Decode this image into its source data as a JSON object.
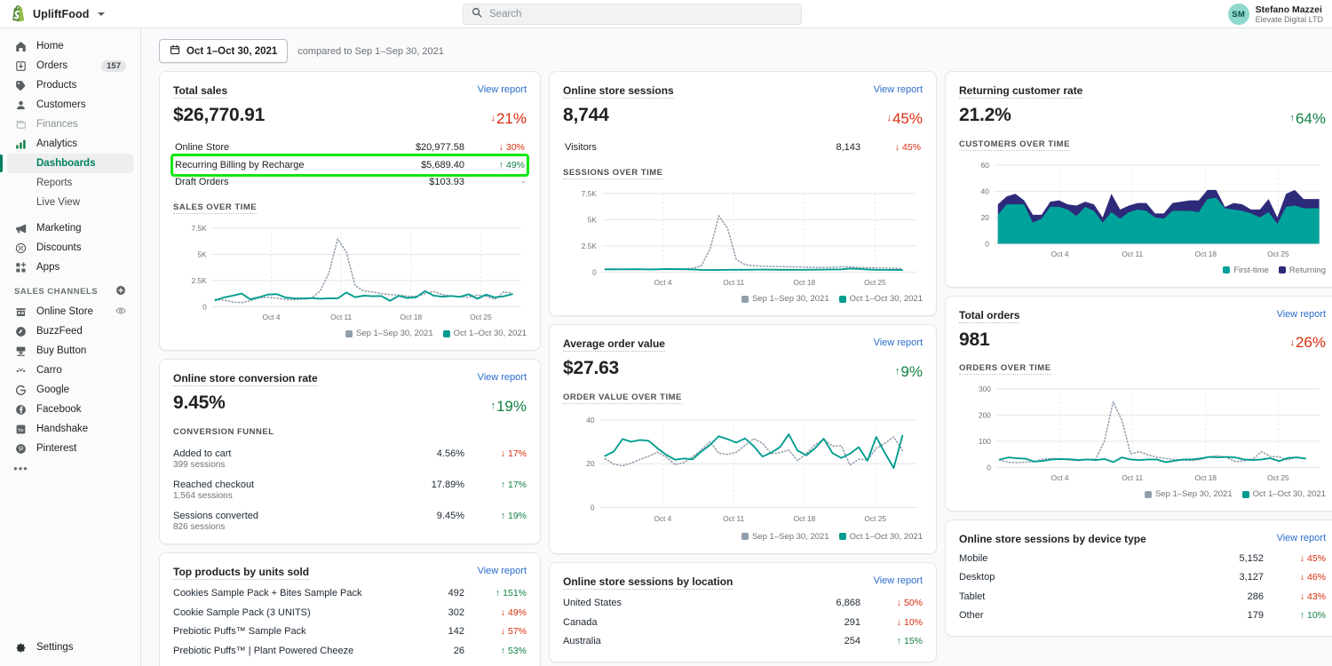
{
  "topbar": {
    "brand_name": "UpliftFood",
    "search_placeholder": "Search",
    "search_value": "",
    "user_initials": "SM",
    "user_name": "Stefano Mazzei",
    "user_org": "Elevate Digital LTD"
  },
  "sidebar": {
    "items": [
      {
        "label": "Home",
        "icon": "home-icon",
        "badge": ""
      },
      {
        "label": "Orders",
        "icon": "orders-icon",
        "badge": "157"
      },
      {
        "label": "Products",
        "icon": "products-icon",
        "badge": ""
      },
      {
        "label": "Customers",
        "icon": "customers-icon",
        "badge": ""
      },
      {
        "label": "Finances",
        "icon": "finances-icon",
        "badge": "",
        "muted": true
      },
      {
        "label": "Analytics",
        "icon": "analytics-icon",
        "badge": ""
      }
    ],
    "analytics_sub": [
      {
        "label": "Dashboards",
        "active": true
      },
      {
        "label": "Reports",
        "active": false
      },
      {
        "label": "Live View",
        "active": false
      }
    ],
    "items2": [
      {
        "label": "Marketing",
        "icon": "marketing-icon"
      },
      {
        "label": "Discounts",
        "icon": "discounts-icon"
      },
      {
        "label": "Apps",
        "icon": "apps-icon"
      }
    ],
    "channels_header": "SALES CHANNELS",
    "channels": [
      {
        "label": "Online Store",
        "icon": "store-icon",
        "eye": true
      },
      {
        "label": "BuzzFeed",
        "icon": "buzzfeed-icon"
      },
      {
        "label": "Buy Button",
        "icon": "buy-button-icon"
      },
      {
        "label": "Carro",
        "icon": "carro-icon"
      },
      {
        "label": "Google",
        "icon": "google-icon"
      },
      {
        "label": "Facebook",
        "icon": "facebook-icon"
      },
      {
        "label": "Handshake",
        "icon": "handshake-icon"
      },
      {
        "label": "Pinterest",
        "icon": "pinterest-icon"
      }
    ],
    "more_label": "•••",
    "settings_label": "Settings"
  },
  "daterange": {
    "selected": "Oct 1–Oct 30, 2021",
    "compare_text": "compared to Sep 1–Sep 30, 2021"
  },
  "common": {
    "view_report": "View report",
    "legend_previous": "Sep 1–Sep 30, 2021",
    "legend_current": "Oct 1–Oct 30, 2021",
    "color_current": "#009c8f",
    "color_previous": "#919eab",
    "color_returning": "#2e2a7a",
    "color_up": "#108043",
    "color_down": "#d72c0d",
    "highlight_color": "#12e712"
  },
  "cards": {
    "total_sales": {
      "title": "Total sales",
      "value": "$26,770.91",
      "delta": "21%",
      "delta_dir": "down",
      "rows": [
        {
          "name": "Online Store",
          "value": "$20,977.58",
          "change": "30%",
          "dir": "down",
          "highlighted": false
        },
        {
          "name": "Recurring Billing by Recharge",
          "value": "$5,689.40",
          "change": "49%",
          "dir": "up",
          "highlighted": true
        },
        {
          "name": "Draft Orders",
          "value": "$103.93",
          "change": "-",
          "dir": "none",
          "highlighted": false
        }
      ],
      "chart_label": "SALES OVER TIME"
    },
    "conversion": {
      "title": "Online store conversion rate",
      "value": "9.45%",
      "delta": "19%",
      "delta_dir": "up",
      "funnel_label": "CONVERSION FUNNEL",
      "funnel": [
        {
          "name": "Added to cart",
          "sub": "399 sessions",
          "pct": "4.56%",
          "change": "17%",
          "dir": "down"
        },
        {
          "name": "Reached checkout",
          "sub": "1,564 sessions",
          "pct": "17.89%",
          "change": "17%",
          "dir": "up"
        },
        {
          "name": "Sessions converted",
          "sub": "826 sessions",
          "pct": "9.45%",
          "change": "19%",
          "dir": "up"
        }
      ]
    },
    "top_products": {
      "title": "Top products by units sold",
      "rows": [
        {
          "name": "Cookies Sample Pack + Bites Sample Pack",
          "value": "492",
          "change": "151%",
          "dir": "up"
        },
        {
          "name": "Cookie Sample Pack (3 UNITS)",
          "value": "302",
          "change": "49%",
          "dir": "down"
        },
        {
          "name": "Prebiotic Puffs™ Sample Pack",
          "value": "142",
          "change": "57%",
          "dir": "down"
        },
        {
          "name": "Prebiotic Puffs™ | Plant Powered Cheeze",
          "value": "26",
          "change": "53%",
          "dir": "up"
        }
      ]
    },
    "sessions": {
      "title": "Online store sessions",
      "value": "8,744",
      "delta": "45%",
      "delta_dir": "down",
      "rows": [
        {
          "name": "Visitors",
          "value": "8,143",
          "change": "45%",
          "dir": "down"
        }
      ],
      "chart_label": "SESSIONS OVER TIME"
    },
    "aov": {
      "title": "Average order value",
      "value": "$27.63",
      "delta": "9%",
      "delta_dir": "up",
      "chart_label": "ORDER VALUE OVER TIME"
    },
    "sessions_location": {
      "title": "Online store sessions by location",
      "rows": [
        {
          "name": "United States",
          "value": "6,868",
          "change": "50%",
          "dir": "down"
        },
        {
          "name": "Canada",
          "value": "291",
          "change": "10%",
          "dir": "down"
        },
        {
          "name": "Australia",
          "value": "254",
          "change": "15%",
          "dir": "up"
        }
      ]
    },
    "returning": {
      "title": "Returning customer rate",
      "value": "21.2%",
      "delta": "64%",
      "delta_dir": "up",
      "chart_label": "CUSTOMERS OVER TIME",
      "legend_first": "First-time",
      "legend_returning": "Returning"
    },
    "total_orders": {
      "title": "Total orders",
      "value": "981",
      "delta": "26%",
      "delta_dir": "down",
      "chart_label": "ORDERS OVER TIME"
    },
    "device_type": {
      "title": "Online store sessions by device type",
      "rows": [
        {
          "name": "Mobile",
          "value": "5,152",
          "change": "45%",
          "dir": "down"
        },
        {
          "name": "Desktop",
          "value": "3,127",
          "change": "46%",
          "dir": "down"
        },
        {
          "name": "Tablet",
          "value": "286",
          "change": "43%",
          "dir": "down"
        },
        {
          "name": "Other",
          "value": "179",
          "change": "10%",
          "dir": "up"
        }
      ]
    }
  },
  "chart_data": [
    {
      "id": "sales_over_time",
      "type": "line",
      "title": "SALES OVER TIME",
      "ylabel": "",
      "xlabel": "",
      "ylim": [
        0,
        7500
      ],
      "yticks": [
        0,
        2500,
        5000,
        7500
      ],
      "ytick_labels": [
        "0",
        "2.5K",
        "5K",
        "7.5K"
      ],
      "xticks": [
        "Oct 4",
        "Oct 11",
        "Oct 18",
        "Oct 25"
      ],
      "grid": true,
      "legend_position": "bottom-right",
      "series": [
        {
          "name": "Oct 1–Oct 30, 2021",
          "style": "solid",
          "color": "#009c8f",
          "values": [
            620,
            880,
            1050,
            1250,
            700,
            900,
            1150,
            1200,
            880,
            800,
            780,
            820,
            760,
            800,
            780,
            1350,
            900,
            1050,
            1000,
            1020,
            560,
            1030,
            830,
            900,
            1480,
            1050,
            960,
            1020,
            930,
            1180,
            760,
            1150,
            880,
            980,
            1200
          ]
        },
        {
          "name": "Sep 1–Sep 30, 2021",
          "style": "dotted",
          "color": "#919eab",
          "values": [
            700,
            620,
            430,
            380,
            560,
            850,
            900,
            820,
            700,
            650,
            720,
            800,
            1500,
            3200,
            6450,
            5200,
            2000,
            1500,
            1400,
            1250,
            1150,
            1100,
            1000,
            980,
            1250,
            1450,
            1150,
            1000,
            950,
            900,
            1100,
            1000,
            700,
            1400,
            1300
          ]
        }
      ]
    },
    {
      "id": "sessions_over_time",
      "type": "line",
      "title": "SESSIONS OVER TIME",
      "ylim": [
        0,
        7500
      ],
      "yticks": [
        0,
        2500,
        5000,
        7500
      ],
      "ytick_labels": [
        "0",
        "2.5K",
        "5K",
        "7.5K"
      ],
      "xticks": [
        "Oct 4",
        "Oct 11",
        "Oct 18",
        "Oct 25"
      ],
      "grid": true,
      "legend_position": "bottom-right",
      "series": [
        {
          "name": "Oct 1–Oct 30, 2021",
          "style": "solid",
          "color": "#009c8f",
          "values": [
            250,
            260,
            255,
            270,
            265,
            250,
            260,
            280,
            270,
            265,
            250,
            200,
            190,
            200,
            210,
            215,
            220,
            225,
            230,
            225,
            220,
            215,
            210,
            215,
            225,
            230,
            240,
            260,
            330,
            300,
            250,
            220,
            210,
            200,
            195
          ]
        },
        {
          "name": "Sep 1–Sep 30, 2021",
          "style": "dotted",
          "color": "#919eab",
          "values": [
            300,
            280,
            250,
            230,
            240,
            260,
            270,
            280,
            300,
            320,
            340,
            600,
            2200,
            5350,
            4200,
            1200,
            700,
            600,
            560,
            540,
            520,
            500,
            480,
            460,
            450,
            440,
            470,
            500,
            480,
            430,
            420,
            400,
            380,
            360,
            340
          ]
        }
      ]
    },
    {
      "id": "order_value_over_time",
      "type": "line",
      "title": "ORDER VALUE OVER TIME",
      "ylim": [
        0,
        40
      ],
      "yticks": [
        0,
        20,
        40
      ],
      "ytick_labels": [
        "0",
        "20",
        "40"
      ],
      "xticks": [
        "Oct 4",
        "Oct 11",
        "Oct 18",
        "Oct 25"
      ],
      "grid": true,
      "legend_position": "bottom-right",
      "series": [
        {
          "name": "Oct 1–Oct 30, 2021",
          "style": "solid",
          "color": "#009c8f",
          "values": [
            23.5,
            25.5,
            31.2,
            30.0,
            30.8,
            30.4,
            27.0,
            24.0,
            21.8,
            22.3,
            21.9,
            25.5,
            28.5,
            32.5,
            31.2,
            29.6,
            31.5,
            28.0,
            23.2,
            25.0,
            27.5,
            33.4,
            26.0,
            24.2,
            27.5,
            31.4,
            24.8,
            22.6,
            24.5,
            27.3,
            21.3,
            32.2,
            25.2,
            22.5,
            32.8
          ]
        },
        {
          "name": "Sep 1–Sep 30, 2021",
          "style": "dotted",
          "color": "#919eab",
          "values": [
            22.2,
            19.8,
            19.0,
            20.2,
            21.9,
            23.4,
            25.2,
            23.0,
            19.5,
            20.4,
            23.0,
            26.2,
            30.0,
            24.8,
            24.2,
            25.2,
            28.3,
            31.4,
            29.5,
            24.5,
            25.0,
            26.2,
            21.5,
            24.5,
            27.8,
            30.2,
            28.0,
            28.2,
            19.5,
            22.0,
            21.7,
            27.0,
            29.5,
            32.2,
            26.0
          ]
        }
      ]
    },
    {
      "id": "customers_over_time",
      "type": "area",
      "title": "CUSTOMERS OVER TIME",
      "ylim": [
        0,
        60
      ],
      "yticks": [
        0,
        20,
        40,
        60
      ],
      "ytick_labels": [
        "0",
        "20",
        "40",
        "60"
      ],
      "xticks": [
        "Oct 4",
        "Oct 11",
        "Oct 18",
        "Oct 25"
      ],
      "grid": true,
      "stacked": true,
      "legend_position": "bottom-right",
      "series": [
        {
          "name": "First-time",
          "color": "#009c8f",
          "values": [
            22,
            30,
            30,
            30,
            16,
            19,
            28,
            28,
            26,
            21,
            28,
            25,
            16,
            24,
            19,
            24,
            26,
            25,
            20,
            19,
            25,
            25,
            25,
            24,
            34,
            35,
            27,
            26,
            25,
            23,
            20,
            24,
            15,
            28,
            29,
            27
          ]
        },
        {
          "name": "Returning",
          "color": "#2e2a7a",
          "values": [
            8,
            6,
            8,
            3,
            6,
            3,
            4,
            5,
            4,
            8,
            4,
            5,
            4,
            14,
            7,
            5,
            5,
            6,
            3,
            4,
            6,
            7,
            8,
            9,
            7,
            6,
            1,
            5,
            5,
            3,
            6,
            10,
            5,
            10,
            12,
            7
          ]
        }
      ]
    },
    {
      "id": "orders_over_time",
      "type": "line",
      "title": "ORDERS OVER TIME",
      "ylim": [
        0,
        300
      ],
      "yticks": [
        0,
        100,
        200,
        300
      ],
      "ytick_labels": [
        "0",
        "100",
        "200",
        "300"
      ],
      "xticks": [
        "Oct 4",
        "Oct 11",
        "Oct 18",
        "Oct 25"
      ],
      "grid": true,
      "legend_position": "bottom-right",
      "series": [
        {
          "name": "Oct 1–Oct 30, 2021",
          "style": "solid",
          "color": "#009c8f",
          "values": [
            30,
            38,
            35,
            33,
            22,
            25,
            30,
            32,
            31,
            28,
            30,
            28,
            32,
            20,
            38,
            30,
            28,
            30,
            30,
            20,
            25,
            30,
            30,
            34,
            40,
            38,
            40,
            38,
            30,
            28,
            30,
            35,
            24,
            36,
            38,
            34
          ]
        },
        {
          "name": "Sep 1–Sep 30, 2021",
          "style": "dotted",
          "color": "#919eab",
          "values": [
            28,
            20,
            18,
            20,
            22,
            32,
            34,
            33,
            28,
            26,
            30,
            32,
            100,
            250,
            180,
            52,
            60,
            48,
            38,
            34,
            30,
            28,
            26,
            30,
            40,
            45,
            38,
            22,
            25,
            32,
            60,
            42,
            40,
            28,
            40,
            33
          ]
        }
      ]
    }
  ]
}
